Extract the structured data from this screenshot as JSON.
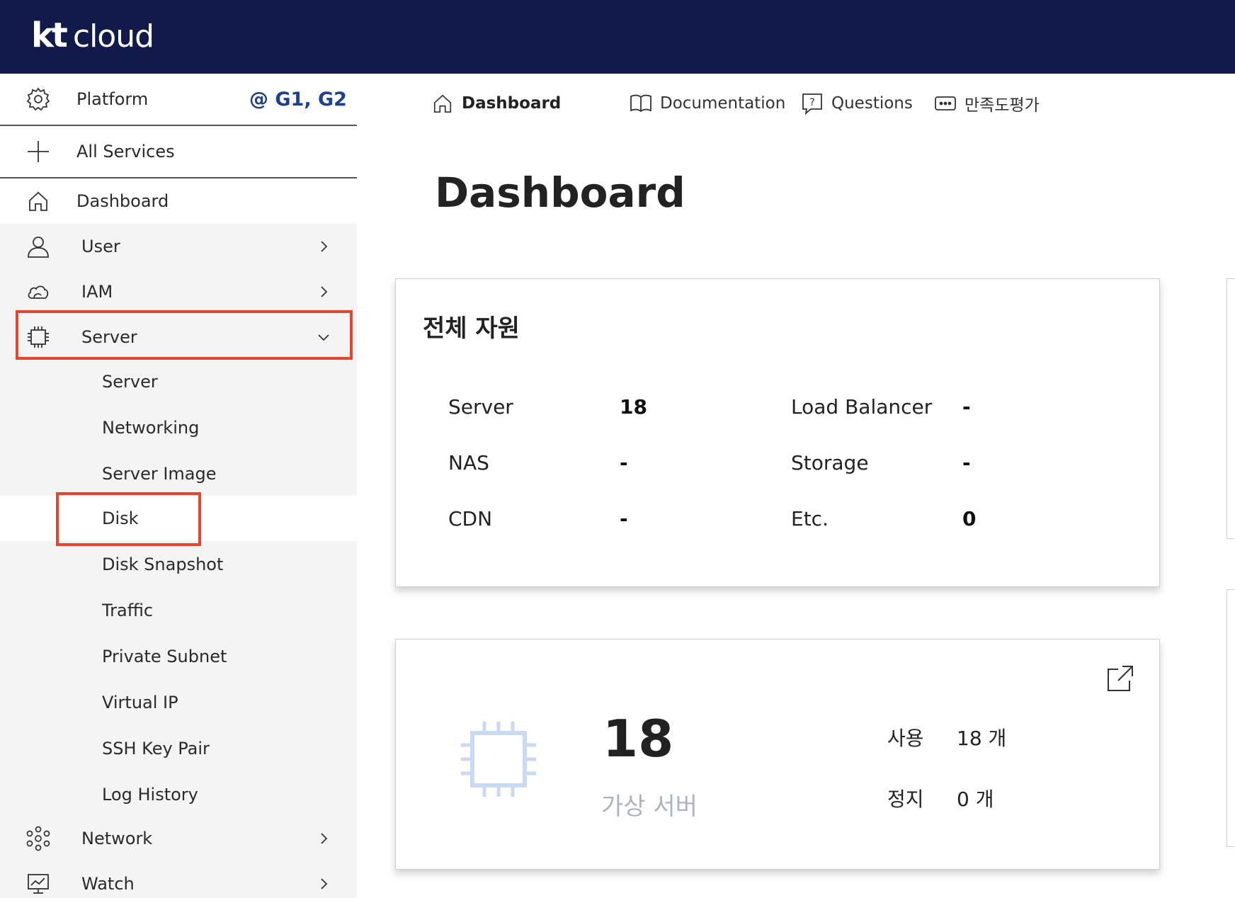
{
  "brand": {
    "kt": "kt",
    "cloud": "cloud"
  },
  "sidebar": {
    "platform": {
      "label": "Platform",
      "value": "@ G1, G2"
    },
    "all_services": "All Services",
    "dashboard": "Dashboard",
    "items": [
      {
        "label": "User",
        "icon": "user-icon"
      },
      {
        "label": "IAM",
        "icon": "cloud-icon"
      },
      {
        "label": "Server",
        "icon": "chip-icon"
      }
    ],
    "server_sub": [
      "Server",
      "Networking",
      "Server Image",
      "Disk",
      "Disk Snapshot",
      "Traffic",
      "Private Subnet",
      "Virtual IP",
      "SSH Key Pair",
      "Log History"
    ],
    "bottom_items": [
      {
        "label": "Network",
        "icon": "network-icon"
      },
      {
        "label": "Watch",
        "icon": "monitor-icon"
      }
    ]
  },
  "topnav": {
    "dashboard": "Dashboard",
    "documentation": "Documentation",
    "questions": "Questions",
    "survey": "만족도평가"
  },
  "page": {
    "title": "Dashboard"
  },
  "total_resources": {
    "title": "전체 자원",
    "rows": [
      {
        "l1": "Server",
        "v1": "18",
        "l2": "Load Balancer",
        "v2": "-"
      },
      {
        "l1": "NAS",
        "v1": "-",
        "l2": "Storage",
        "v2": "-"
      },
      {
        "l1": "CDN",
        "v1": "-",
        "l2": "Etc.",
        "v2": "0"
      }
    ]
  },
  "vm_card": {
    "count": "18",
    "label": "가상 서버",
    "used_label": "사용",
    "used_value": "18 개",
    "stopped_label": "정지",
    "stopped_value": "0 개"
  },
  "colors": {
    "topbar": "#111a4a",
    "highlight": "#e5452c",
    "platform_value": "#1f3f8f",
    "chip_icon": "#c9daf0"
  }
}
